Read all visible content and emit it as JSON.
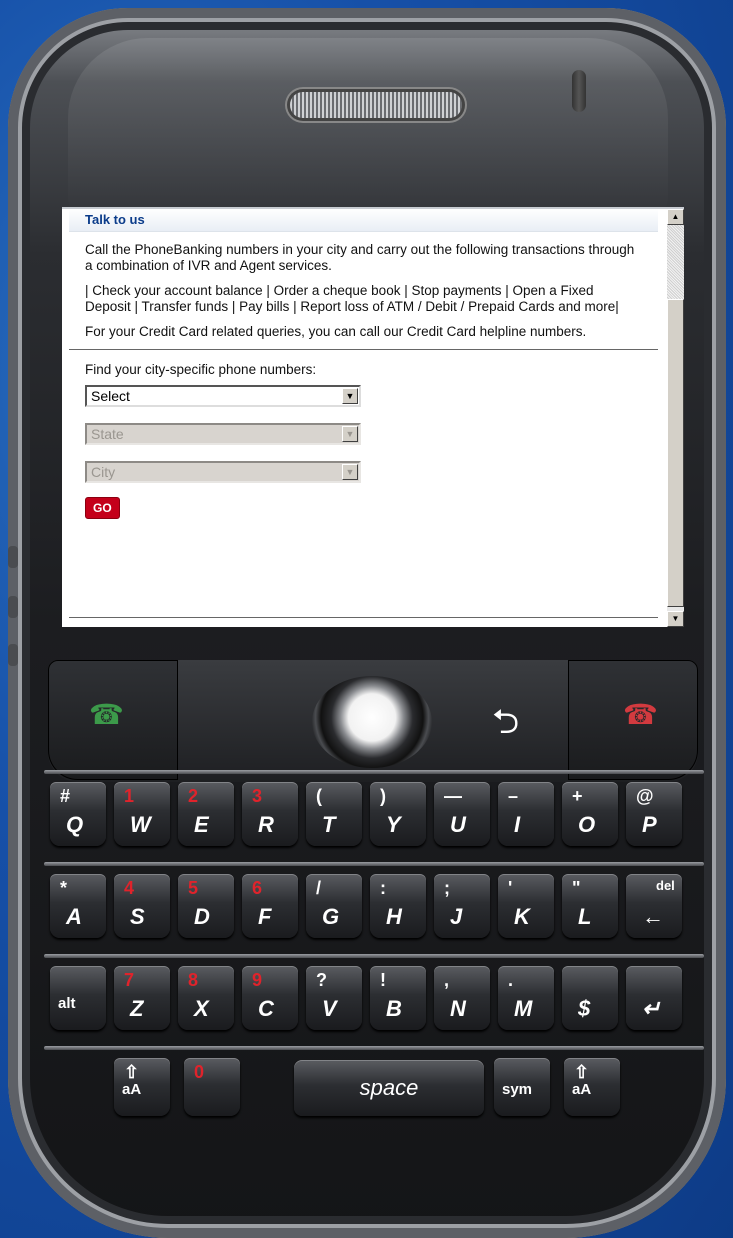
{
  "screen": {
    "header_title": "Talk to us",
    "paragraphs": [
      "Call the PhoneBanking numbers in your city and carry out the following transactions through a combination of IVR and Agent services.",
      "| Check your account balance | Order a cheque book | Stop payments | Open a Fixed Deposit | Transfer funds | Pay bills | Report loss of ATM / Debit / Prepaid Cards and more|",
      "For your Credit Card related queries, you can call our Credit Card helpline numbers."
    ],
    "finder_label": "Find your city-specific phone numbers:",
    "select_type": "Select",
    "select_state": "State",
    "select_city": "City",
    "go_label": "GO"
  },
  "keyboard": {
    "row1": [
      {
        "main": "Q",
        "alt": "#",
        "red": false
      },
      {
        "main": "W",
        "alt": "1",
        "red": true
      },
      {
        "main": "E",
        "alt": "2",
        "red": true
      },
      {
        "main": "R",
        "alt": "3",
        "red": true
      },
      {
        "main": "T",
        "alt": "(",
        "red": false
      },
      {
        "main": "Y",
        "alt": ")",
        "red": false
      },
      {
        "main": "U",
        "alt": "—",
        "red": false
      },
      {
        "main": "I",
        "alt": "–",
        "red": false
      },
      {
        "main": "O",
        "alt": "+",
        "red": false
      },
      {
        "main": "P",
        "alt": "@",
        "red": false
      }
    ],
    "row2": [
      {
        "main": "A",
        "alt": "*",
        "red": false
      },
      {
        "main": "S",
        "alt": "4",
        "red": true
      },
      {
        "main": "D",
        "alt": "5",
        "red": true
      },
      {
        "main": "F",
        "alt": "6",
        "red": true
      },
      {
        "main": "G",
        "alt": "/",
        "red": false
      },
      {
        "main": "H",
        "alt": ":",
        "red": false
      },
      {
        "main": "J",
        "alt": ";",
        "red": false
      },
      {
        "main": "K",
        "alt": "'",
        "red": false
      },
      {
        "main": "L",
        "alt": "\"",
        "red": false
      },
      {
        "main": "←",
        "alt": "del",
        "red": false
      }
    ],
    "row3": [
      {
        "main": "alt",
        "alt": "",
        "red": false
      },
      {
        "main": "Z",
        "alt": "7",
        "red": true
      },
      {
        "main": "X",
        "alt": "8",
        "red": true
      },
      {
        "main": "C",
        "alt": "9",
        "red": true
      },
      {
        "main": "V",
        "alt": "?",
        "red": false
      },
      {
        "main": "B",
        "alt": "!",
        "red": false
      },
      {
        "main": "N",
        "alt": ",",
        "red": false
      },
      {
        "main": "M",
        "alt": ".",
        "red": false
      },
      {
        "main": "$",
        "alt": "",
        "red": false
      },
      {
        "main": "↵",
        "alt": "",
        "red": false
      }
    ],
    "row4": [
      {
        "main": "aA",
        "alt": "⇧",
        "red": false
      },
      {
        "main": "",
        "alt": "0",
        "red": true
      },
      {
        "main": "sym",
        "alt": "",
        "red": false
      },
      {
        "main": "aA",
        "alt": "⇧",
        "red": false
      }
    ],
    "space_label": "space"
  },
  "colors": {
    "brand_blue": "#0b3c8a",
    "go_red": "#c4001a",
    "call_green": "#3c9a4a",
    "end_red": "#d23a3f"
  }
}
